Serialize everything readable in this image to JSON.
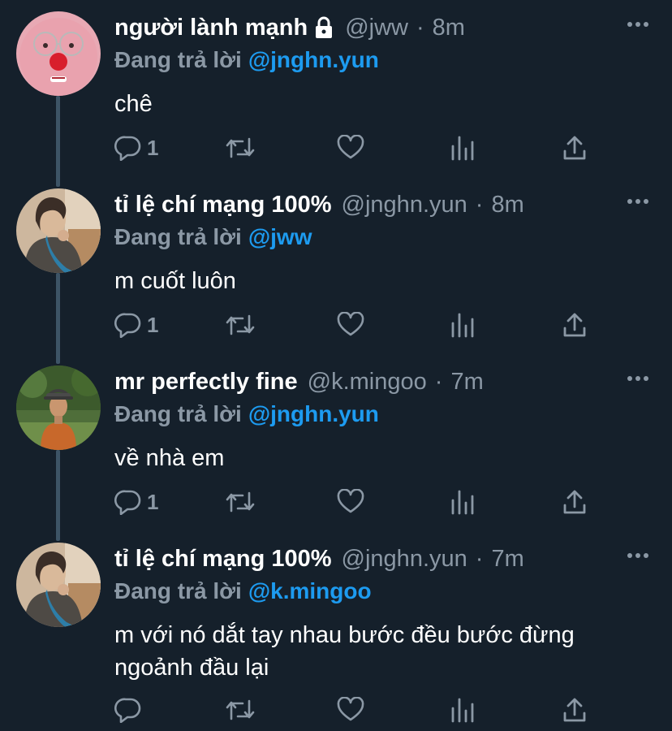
{
  "tweets": [
    {
      "name": "người lành mạnh",
      "handle": "@jww",
      "separator": "·",
      "time": "8m",
      "replying_label": "Đang trả lời",
      "reply_to": "@jnghn.yun",
      "text": "chê",
      "reply_count": "1",
      "locked": true,
      "avatar": "pink-plush-with-glasses-avatar"
    },
    {
      "name": "tỉ lệ chí mạng 100%",
      "handle": "@jnghn.yun",
      "separator": "·",
      "time": "8m",
      "replying_label": "Đang trả lời",
      "reply_to": "@jww",
      "text": "m cuốt luôn",
      "reply_count": "1",
      "locked": false,
      "avatar": "person-photo-avatar"
    },
    {
      "name": "mr perfectly fine",
      "handle": "@k.mingoo",
      "separator": "·",
      "time": "7m",
      "replying_label": "Đang trả lời",
      "reply_to": "@jnghn.yun",
      "text": "về nhà em",
      "reply_count": "1",
      "locked": false,
      "avatar": "man-outdoors-orange-shirt-avatar"
    },
    {
      "name": "tỉ lệ chí mạng 100%",
      "handle": "@jnghn.yun",
      "separator": "·",
      "time": "7m",
      "replying_label": "Đang trả lời",
      "reply_to": "@k.mingoo",
      "text": "m với nó dắt tay nhau bước đều bước đừng ngoảnh đầu lại",
      "reply_count": "",
      "locked": false,
      "avatar": "person-photo-avatar"
    }
  ],
  "colors": {
    "background": "#15202b",
    "text": "#ffffff",
    "secondary": "#8b98a5",
    "accent": "#1d9bf0",
    "thread_line": "#3d5466"
  },
  "icons": {
    "reply": "comment-icon",
    "retweet": "retweet-icon",
    "like": "heart-icon",
    "analytics": "analytics-icon",
    "share": "share-icon",
    "more": "more-icon",
    "lock": "lock-icon"
  }
}
